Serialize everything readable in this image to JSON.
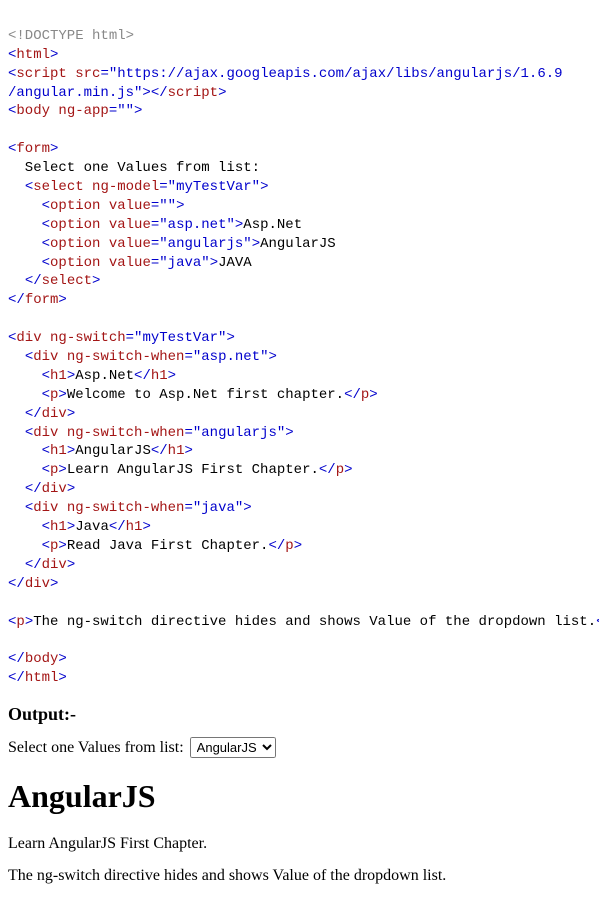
{
  "code": {
    "l1_doctype": "<!DOCTYPE html>",
    "l2_open_tag": "<",
    "l2_tag": "html",
    "l2_close": ">",
    "l3_open": "<",
    "l3_tag": "script",
    "l3_attr1": " src",
    "l3_eq": "=",
    "l3_val1": "\"https://ajax.googleapis.com/ajax/libs/angularjs/1.6.9",
    "l3_val2": "/angular.min.js\"",
    "l3_gt": ">",
    "l3_close_open": "</",
    "l3_close_tag": "script",
    "l3_close_gt": ">",
    "l4_open": "<",
    "l4_tag": "body",
    "l4_attr": " ng-app",
    "l4_val": "\"\"",
    "l4_gt": ">",
    "l5_open": "<",
    "l5_tag": "form",
    "l5_gt": ">",
    "l6_text": "  Select one Values from list:",
    "l7_indent": "  ",
    "l7_open": "<",
    "l7_tag": "select",
    "l7_attr": " ng-model",
    "l7_val": "\"myTestVar\"",
    "l7_gt": ">",
    "l8_indent": "    ",
    "l8_open": "<",
    "l8_tag": "option",
    "l8_attr": " value",
    "l8_val": "\"\"",
    "l8_gt": ">",
    "l9_indent": "    ",
    "l9_open": "<",
    "l9_tag": "option",
    "l9_attr": " value",
    "l9_val": "\"asp.net\"",
    "l9_gt": ">",
    "l9_text": "Asp.Net",
    "l10_indent": "    ",
    "l10_open": "<",
    "l10_tag": "option",
    "l10_attr": " value",
    "l10_val": "\"angularjs\"",
    "l10_gt": ">",
    "l10_text": "AngularJS",
    "l11_indent": "    ",
    "l11_open": "<",
    "l11_tag": "option",
    "l11_attr": " value",
    "l11_val": "\"java\"",
    "l11_gt": ">",
    "l11_text": "JAVA",
    "l12_indent": "  ",
    "l12_open": "</",
    "l12_tag": "select",
    "l12_gt": ">",
    "l13_open": "</",
    "l13_tag": "form",
    "l13_gt": ">",
    "l14_open": "<",
    "l14_tag": "div",
    "l14_attr": " ng-switch",
    "l14_val": "\"myTestVar\"",
    "l14_gt": ">",
    "l15_indent": "  ",
    "l15_open": "<",
    "l15_tag": "div",
    "l15_attr": " ng-switch-when",
    "l15_val": "\"asp.net\"",
    "l15_gt": ">",
    "l16_indent": "    ",
    "l16_open": "<",
    "l16_tag": "h1",
    "l16_gt": ">",
    "l16_text": "Asp.Net",
    "l16_close_open": "</",
    "l16_close_gt": ">",
    "l17_indent": "    ",
    "l17_open": "<",
    "l17_tag": "p",
    "l17_gt": ">",
    "l17_text": "Welcome to Asp.Net first chapter.",
    "l17_close_open": "</",
    "l17_close_gt": ">",
    "l18_indent": "  ",
    "l18_open": "</",
    "l18_tag": "div",
    "l18_gt": ">",
    "l19_indent": "  ",
    "l19_open": "<",
    "l19_tag": "div",
    "l19_attr": " ng-switch-when",
    "l19_val": "\"angularjs\"",
    "l19_gt": ">",
    "l20_indent": "    ",
    "l20_open": "<",
    "l20_tag": "h1",
    "l20_gt": ">",
    "l20_text": "AngularJS",
    "l20_close_open": "</",
    "l20_close_gt": ">",
    "l21_indent": "    ",
    "l21_open": "<",
    "l21_tag": "p",
    "l21_gt": ">",
    "l21_text": "Learn AngularJS First Chapter.",
    "l21_close_open": "</",
    "l21_close_gt": ">",
    "l22_indent": "  ",
    "l22_open": "</",
    "l22_tag": "div",
    "l22_gt": ">",
    "l23_indent": "  ",
    "l23_open": "<",
    "l23_tag": "div",
    "l23_attr": " ng-switch-when",
    "l23_val": "\"java\"",
    "l23_gt": ">",
    "l24_indent": "    ",
    "l24_open": "<",
    "l24_tag": "h1",
    "l24_gt": ">",
    "l24_text": "Java",
    "l24_close_open": "</",
    "l24_close_gt": ">",
    "l25_indent": "    ",
    "l25_open": "<",
    "l25_tag": "p",
    "l25_gt": ">",
    "l25_text": "Read Java First Chapter.",
    "l25_close_open": "</",
    "l25_close_gt": ">",
    "l26_indent": "  ",
    "l26_open": "</",
    "l26_tag": "div",
    "l26_gt": ">",
    "l27_open": "</",
    "l27_tag": "div",
    "l27_gt": ">",
    "l28_open": "<",
    "l28_tag": "p",
    "l28_gt": ">",
    "l28_text": "The ng-switch directive hides and shows Value of the dropdown list.",
    "l28_close_open": "</",
    "l28_close_gt": ">",
    "l29_open": "</",
    "l29_tag": "body",
    "l29_gt": ">",
    "l30_open": "</",
    "l30_tag": "html",
    "l30_gt": ">"
  },
  "output": {
    "label": "Output:-",
    "select_label": "Select one Values from list:",
    "selected": "AngularJS",
    "options": [
      "",
      "Asp.Net",
      "AngularJS",
      "JAVA"
    ],
    "heading": "AngularJS",
    "para1": "Learn AngularJS First Chapter.",
    "para2": "The ng-switch directive hides and shows Value of the dropdown list."
  }
}
